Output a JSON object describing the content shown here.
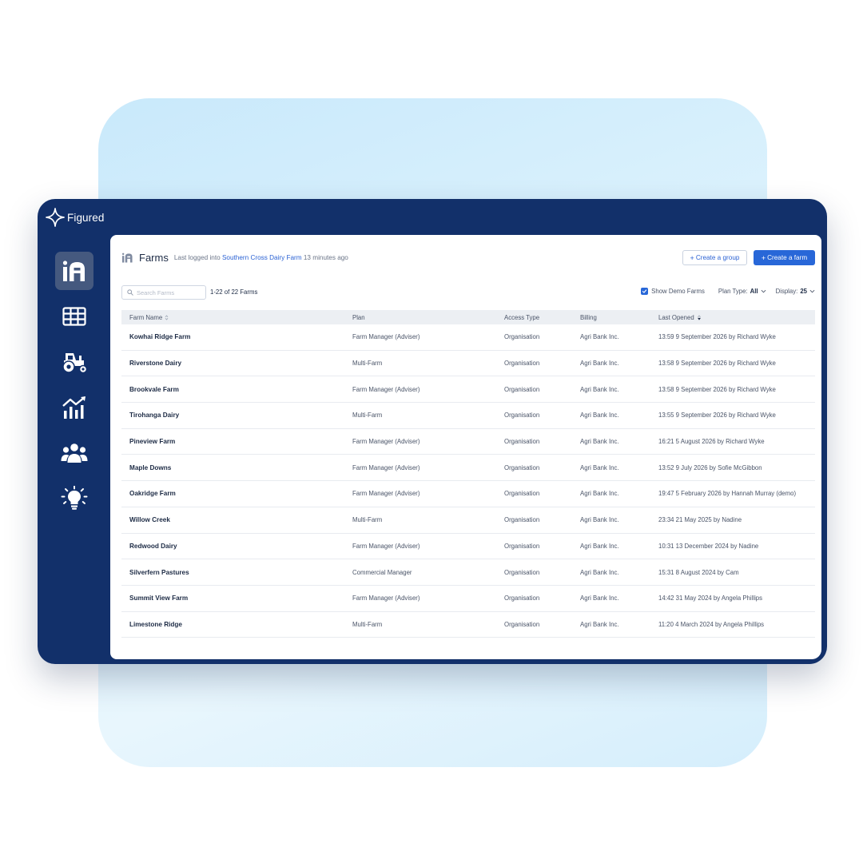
{
  "brand": {
    "name": "Figured"
  },
  "sidebar": {
    "items": [
      {
        "id": "farms",
        "icon": "farms-logo-icon",
        "active": true
      },
      {
        "id": "grid",
        "icon": "grid-icon",
        "active": false
      },
      {
        "id": "tractor",
        "icon": "tractor-icon",
        "active": false
      },
      {
        "id": "reports",
        "icon": "chart-icon",
        "active": false
      },
      {
        "id": "users",
        "icon": "users-icon",
        "active": false
      },
      {
        "id": "insights",
        "icon": "lightbulb-icon",
        "active": false
      }
    ]
  },
  "header": {
    "title": "Farms",
    "last_login_prefix": "Last logged into",
    "last_login_farm": "Southern Cross Dairy Farm",
    "last_login_time": "13 minutes ago",
    "create_group_label": "Create a group",
    "create_farm_label": "Create a farm"
  },
  "toolbar": {
    "search_placeholder": "Search Farms",
    "count_text": "1-22 of 22 Farms",
    "show_demo_label": "Show Demo Farms",
    "show_demo_checked": true,
    "plan_type_label": "Plan Type:",
    "plan_type_value": "All",
    "display_label": "Display:",
    "display_value": "25"
  },
  "table": {
    "columns": [
      "Farm Name",
      "Plan",
      "Access Type",
      "Billing",
      "Last Opened"
    ],
    "rows": [
      [
        "Kowhai Ridge Farm",
        "Farm Manager (Adviser)",
        "Organisation",
        "Agri Bank Inc.",
        "13:59 9 September 2026 by Richard Wyke"
      ],
      [
        "Riverstone Dairy",
        "Multi-Farm",
        "Organisation",
        "Agri Bank Inc.",
        "13:58 9 September 2026 by Richard Wyke"
      ],
      [
        "Brookvale Farm",
        "Farm Manager (Adviser)",
        "Organisation",
        "Agri Bank Inc.",
        "13:58 9 September 2026 by Richard Wyke"
      ],
      [
        "Tirohanga Dairy",
        "Multi-Farm",
        "Organisation",
        "Agri Bank Inc.",
        "13:55 9 September 2026 by Richard Wyke"
      ],
      [
        "Pineview Farm",
        "Farm Manager (Adviser)",
        "Organisation",
        "Agri Bank Inc.",
        "16:21 5 August 2026 by Richard Wyke"
      ],
      [
        "Maple Downs",
        "Farm Manager (Adviser)",
        "Organisation",
        "Agri Bank Inc.",
        "13:52 9 July 2026 by Sofie McGibbon"
      ],
      [
        "Oakridge Farm",
        "Farm Manager (Adviser)",
        "Organisation",
        "Agri Bank Inc.",
        "19:47 5 February 2026 by Hannah Murray (demo)"
      ],
      [
        "Willow Creek",
        "Multi-Farm",
        "Organisation",
        "Agri Bank Inc.",
        "23:34 21 May 2025 by Nadine"
      ],
      [
        "Redwood Dairy",
        "Farm Manager (Adviser)",
        "Organisation",
        "Agri Bank Inc.",
        "10:31 13 December 2024 by Nadine"
      ],
      [
        "Silverfern Pastures",
        "Commercial Manager",
        "Organisation",
        "Agri Bank Inc.",
        "15:31 8 August 2024 by Cam"
      ],
      [
        "Summit View Farm",
        "Farm Manager (Adviser)",
        "Organisation",
        "Agri Bank Inc.",
        "14:42 31 May 2024 by Angela Phillips"
      ],
      [
        "Limestone Ridge",
        "Multi-Farm",
        "Organisation",
        "Agri Bank Inc.",
        "11:20 4 March 2024 by Angela Phillips"
      ]
    ]
  },
  "colors": {
    "sidebar_bg": "#12306a",
    "accent": "#2867d8",
    "link": "#2b62d4"
  }
}
